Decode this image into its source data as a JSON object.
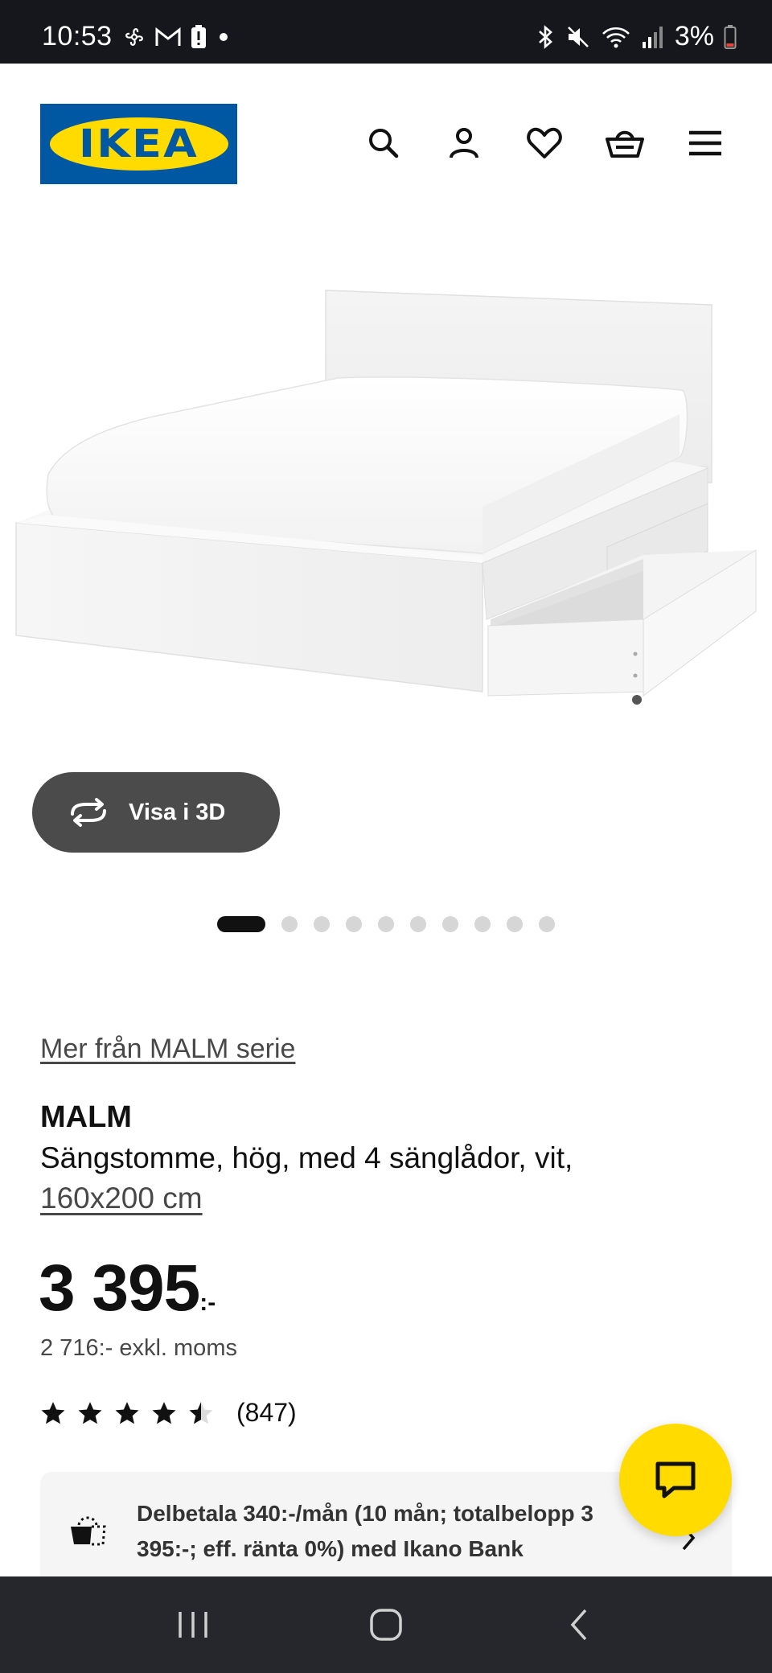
{
  "status_bar": {
    "time": "10:53",
    "battery_text": "3%",
    "left_icons": [
      "fan-icon",
      "gmail-icon",
      "alert-battery-icon",
      "dot-icon"
    ],
    "right_icons": [
      "bluetooth-icon",
      "mute-icon",
      "wifi-icon",
      "signal-icon",
      "battery-icon"
    ]
  },
  "header": {
    "logo_text": "IKEA",
    "icons": [
      "search-icon",
      "account-icon",
      "favorites-icon",
      "cart-icon",
      "menu-icon"
    ]
  },
  "gallery": {
    "view3d_label": "Visa i 3D",
    "dot_count": 10,
    "active_index": 0
  },
  "product": {
    "series_link": "Mer från MALM serie",
    "name": "MALM",
    "description": "Sängstomme, hög, med 4 sänglådor, vit,",
    "size": "160x200 cm",
    "price": "3 395",
    "price_suffix": ":-",
    "price_ex_vat": "2 716:- exkl. moms",
    "rating": 4.5,
    "rating_count": "(847)"
  },
  "finance": {
    "text": "Delbetala 340:-/mån (10 mån; totalbelopp 3 395:-; eff. ränta 0%) med Ikano Bank"
  },
  "colors": {
    "ikea_blue": "#0058a3",
    "ikea_yellow": "#ffdb00",
    "status_bar_bg": "#16171c",
    "nav_bar_bg": "#26272c",
    "button_dark": "#4b4b4b"
  }
}
